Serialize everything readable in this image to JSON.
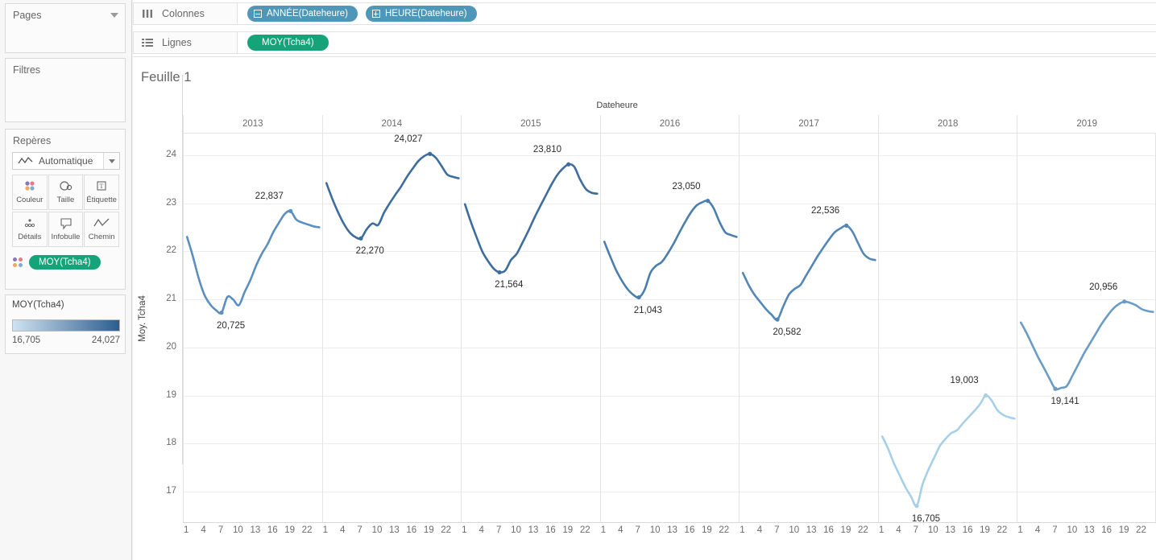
{
  "left_panel": {
    "pages": {
      "title": "Pages",
      "icon": "chevron-down-icon"
    },
    "filters": {
      "title": "Filtres"
    },
    "marks": {
      "title": "Repères",
      "mark_type": "Automatique",
      "buttons": [
        {
          "label": "Couleur",
          "icon": "color-dots-icon"
        },
        {
          "label": "Taille",
          "icon": "size-icon"
        },
        {
          "label": "Étiquette",
          "icon": "label-icon"
        },
        {
          "label": "Détails",
          "icon": "details-icon"
        },
        {
          "label": "Infobulle",
          "icon": "tooltip-icon"
        },
        {
          "label": "Chemin",
          "icon": "path-icon"
        }
      ],
      "color_pill": "MOY(Tcha4)"
    },
    "legend": {
      "title": "MOY(Tcha4)",
      "min": "16,705",
      "max": "24,027",
      "ramp_start": "#cfe2f2",
      "ramp_end": "#2c5e8e"
    }
  },
  "shelves": {
    "columns": {
      "label": "Colonnes",
      "icon": "columns-icon",
      "pills": [
        {
          "text": "ANNÉE(Dateheure)",
          "icon": "collapse-box-icon"
        },
        {
          "text": "HEURE(Dateheure)",
          "icon": "expand-box-icon"
        }
      ]
    },
    "rows": {
      "label": "Lignes",
      "icon": "rows-icon",
      "pills": [
        {
          "text": "MOY(Tcha4)",
          "icon": "none"
        }
      ]
    }
  },
  "view": {
    "sheet_title": "Feuille 1"
  },
  "chart_data": {
    "type": "line",
    "title": "Feuille 1",
    "xlabel": "Dateheure",
    "ylabel": "Moy. Tcha4",
    "ylim": [
      16.35,
      24.45
    ],
    "yticks": [
      17,
      18,
      19,
      20,
      21,
      22,
      23,
      24
    ],
    "xticks": [
      1,
      4,
      7,
      10,
      13,
      16,
      19,
      22
    ],
    "xlim": [
      1,
      24
    ],
    "grid": true,
    "legend_position": "left-panel-color-legend",
    "panel_label": "year",
    "color_encoding": "MOY(Tcha4)",
    "color_domain": [
      16.705,
      24.027
    ],
    "series": [
      {
        "name": "2013",
        "color": "#5b8fc0",
        "x": [
          1,
          2,
          3,
          4,
          5,
          6,
          7,
          8,
          9,
          10,
          11,
          12,
          13,
          14,
          15,
          16,
          17,
          18,
          19,
          20,
          21,
          22,
          23,
          24
        ],
        "values": [
          22.3,
          21.9,
          21.45,
          21.1,
          20.9,
          20.78,
          20.725,
          21.05,
          21.0,
          20.88,
          21.15,
          21.4,
          21.7,
          21.95,
          22.15,
          22.4,
          22.6,
          22.78,
          22.837,
          22.66,
          22.6,
          22.56,
          22.52,
          22.5
        ],
        "min_label": {
          "text": "20,725",
          "x": 7,
          "y": 20.725
        },
        "max_label": {
          "text": "22,837",
          "x": 19,
          "y": 22.837
        }
      },
      {
        "name": "2014",
        "color": "#3d6d9e",
        "x": [
          1,
          2,
          3,
          4,
          5,
          6,
          7,
          8,
          9,
          10,
          11,
          12,
          13,
          14,
          15,
          16,
          17,
          18,
          19,
          20,
          21,
          22,
          23,
          24
        ],
        "values": [
          23.42,
          23.1,
          22.82,
          22.58,
          22.4,
          22.3,
          22.27,
          22.46,
          22.58,
          22.55,
          22.8,
          23.0,
          23.18,
          23.35,
          23.55,
          23.72,
          23.88,
          23.98,
          24.027,
          23.95,
          23.78,
          23.6,
          23.55,
          23.52
        ],
        "min_label": {
          "text": "22,270",
          "x": 7,
          "y": 22.27
        },
        "max_label": {
          "text": "24,027",
          "x": 19,
          "y": 24.027
        }
      },
      {
        "name": "2015",
        "color": "#3d6d9e",
        "x": [
          1,
          2,
          3,
          4,
          5,
          6,
          7,
          8,
          9,
          10,
          11,
          12,
          13,
          14,
          15,
          16,
          17,
          18,
          19,
          20,
          21,
          22,
          23,
          24
        ],
        "values": [
          22.98,
          22.62,
          22.3,
          22.0,
          21.8,
          21.64,
          21.564,
          21.6,
          21.82,
          21.95,
          22.18,
          22.42,
          22.68,
          22.92,
          23.15,
          23.38,
          23.58,
          23.72,
          23.81,
          23.76,
          23.5,
          23.3,
          23.22,
          23.2
        ],
        "min_label": {
          "text": "21,564",
          "x": 7,
          "y": 21.564
        },
        "max_label": {
          "text": "23,810",
          "x": 19,
          "y": 23.81
        }
      },
      {
        "name": "2016",
        "color": "#4a7fad",
        "x": [
          1,
          2,
          3,
          4,
          5,
          6,
          7,
          8,
          9,
          10,
          11,
          12,
          13,
          14,
          15,
          16,
          17,
          18,
          19,
          20,
          21,
          22,
          23,
          24
        ],
        "values": [
          22.2,
          21.9,
          21.62,
          21.4,
          21.22,
          21.1,
          21.043,
          21.2,
          21.55,
          21.7,
          21.78,
          21.95,
          22.15,
          22.38,
          22.6,
          22.8,
          22.95,
          23.02,
          23.05,
          22.9,
          22.62,
          22.4,
          22.34,
          22.3
        ],
        "min_label": {
          "text": "21,043",
          "x": 7,
          "y": 21.043
        },
        "max_label": {
          "text": "23,050",
          "x": 19,
          "y": 23.05
        }
      },
      {
        "name": "2017",
        "color": "#5387b5",
        "x": [
          1,
          2,
          3,
          4,
          5,
          6,
          7,
          8,
          9,
          10,
          11,
          12,
          13,
          14,
          15,
          16,
          17,
          18,
          19,
          20,
          21,
          22,
          23,
          24
        ],
        "values": [
          21.55,
          21.3,
          21.1,
          20.95,
          20.8,
          20.68,
          20.582,
          20.85,
          21.1,
          21.22,
          21.3,
          21.5,
          21.7,
          21.9,
          22.08,
          22.25,
          22.4,
          22.48,
          22.536,
          22.42,
          22.18,
          21.95,
          21.85,
          21.82
        ],
        "min_label": {
          "text": "20,582",
          "x": 7,
          "y": 20.582
        },
        "max_label": {
          "text": "22,536",
          "x": 19,
          "y": 22.536
        }
      },
      {
        "name": "2018",
        "color": "#a8cfe8",
        "x": [
          1,
          2,
          3,
          4,
          5,
          6,
          7,
          8,
          9,
          10,
          11,
          12,
          13,
          14,
          15,
          16,
          17,
          18,
          19,
          20,
          21,
          22,
          23,
          24
        ],
        "values": [
          18.15,
          17.9,
          17.6,
          17.35,
          17.1,
          16.9,
          16.705,
          17.15,
          17.45,
          17.7,
          17.95,
          18.1,
          18.22,
          18.28,
          18.42,
          18.55,
          18.68,
          18.82,
          19.003,
          18.9,
          18.7,
          18.6,
          18.55,
          18.52
        ],
        "min_label": {
          "text": "16,705",
          "x": 7,
          "y": 16.705
        },
        "max_label": {
          "text": "19,003",
          "x": 19,
          "y": 19.003
        }
      },
      {
        "name": "2019",
        "color": "#6a9cc6",
        "x": [
          1,
          2,
          3,
          4,
          5,
          6,
          7,
          8,
          9,
          10,
          11,
          12,
          13,
          14,
          15,
          16,
          17,
          18,
          19,
          20,
          21,
          22,
          23,
          24
        ],
        "values": [
          20.52,
          20.3,
          20.05,
          19.8,
          19.58,
          19.35,
          19.141,
          19.16,
          19.2,
          19.42,
          19.65,
          19.88,
          20.08,
          20.28,
          20.48,
          20.65,
          20.8,
          20.9,
          20.956,
          20.93,
          20.88,
          20.8,
          20.76,
          20.74
        ],
        "min_label": {
          "text": "19,141",
          "x": 7,
          "y": 19.141
        },
        "max_label": {
          "text": "20,956",
          "x": 19,
          "y": 20.956
        }
      }
    ]
  }
}
